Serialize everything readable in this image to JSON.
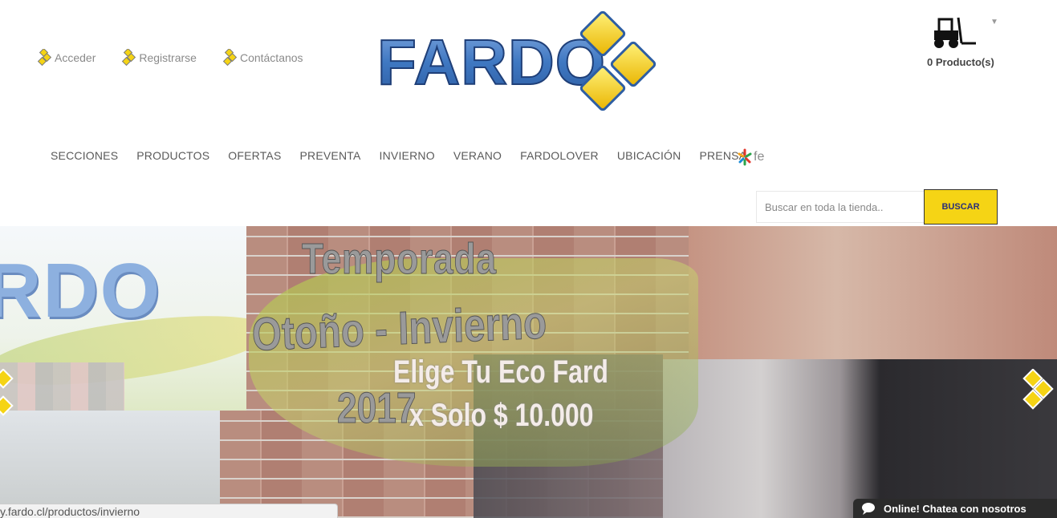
{
  "header": {
    "links": [
      {
        "label": "Acceder"
      },
      {
        "label": "Registrarse"
      },
      {
        "label": "Contáctanos"
      }
    ],
    "logo_text": "FARDO",
    "cart": {
      "count_label": "0 Producto(s)"
    }
  },
  "nav": {
    "items": [
      {
        "label": "SECCIONES"
      },
      {
        "label": "PRODUCTOS"
      },
      {
        "label": "OFERTAS"
      },
      {
        "label": "PREVENTA"
      },
      {
        "label": "INVIERNO"
      },
      {
        "label": "VERANO"
      },
      {
        "label": "FARDOLOVER"
      },
      {
        "label": "UBICACIÓN"
      },
      {
        "label": "PRENSA"
      }
    ],
    "fe_label": "fe"
  },
  "search": {
    "placeholder": "Buscar en toda la tienda..",
    "button_label": "BUSCAR"
  },
  "banner": {
    "logo_text": "RDO",
    "headline_1": "Temporada",
    "headline_2": "Otoño - Invierno",
    "headline_3": "2017",
    "promo_1": "Elige Tu Eco Fard",
    "promo_2": "x Solo $ 10.000"
  },
  "status_bar": {
    "url": "y.fardo.cl/productos/invierno"
  },
  "chat": {
    "label": "Online! Chatea con nosotros"
  },
  "colors": {
    "accent_yellow": "#f5d415",
    "logo_blue": "#3f78c2",
    "button_text": "#2a2f7a"
  }
}
